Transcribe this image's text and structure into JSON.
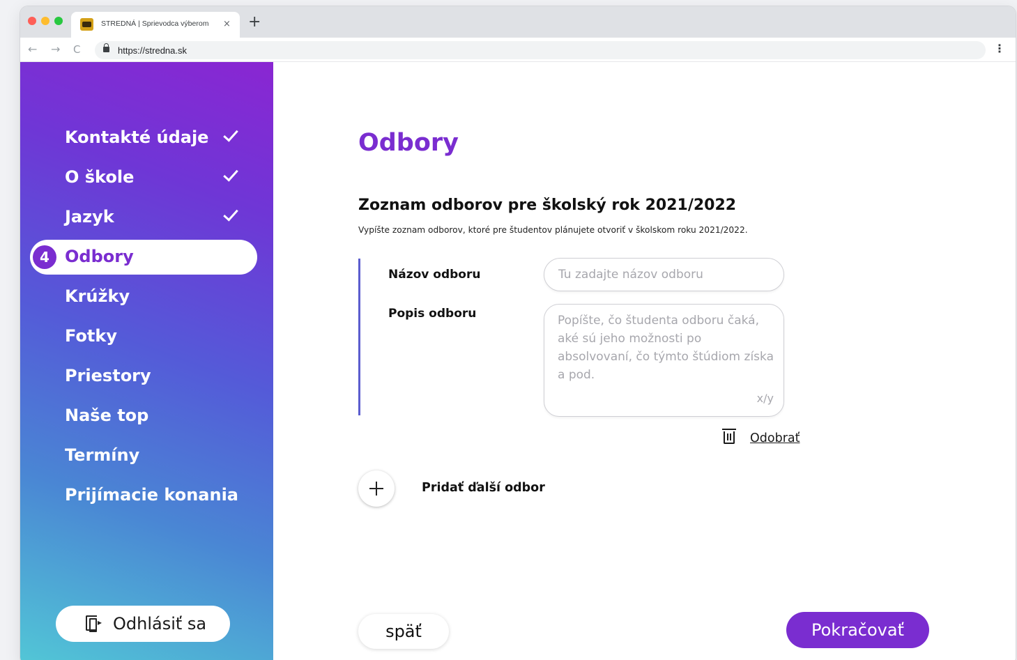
{
  "browser": {
    "tab_title": "STREDNÁ | Sprievodca výberom",
    "tab_close": "×",
    "new_tab": "+",
    "url": "https://stredna.sk",
    "back": "←",
    "forward": "→",
    "reload": "C",
    "menu": "⋮"
  },
  "sidebar": {
    "steps": [
      {
        "label": "Kontakté údaje",
        "state": "done"
      },
      {
        "label": "O škole",
        "state": "done"
      },
      {
        "label": "Jazyk",
        "state": "done"
      },
      {
        "label": "Odbory",
        "state": "active",
        "number": "4"
      },
      {
        "label": "Krúžky",
        "state": "todo"
      },
      {
        "label": "Fotky",
        "state": "todo"
      },
      {
        "label": "Priestory",
        "state": "todo"
      },
      {
        "label": "Naše top",
        "state": "todo"
      },
      {
        "label": "Termíny",
        "state": "todo"
      },
      {
        "label": "Prijímacie konania",
        "state": "todo"
      }
    ],
    "logout_label": "Odhlásiť sa"
  },
  "main": {
    "title": "Odbory",
    "section_title": "Zoznam odborov pre školský rok 2021/2022",
    "section_desc": "Vypíšte zoznam odborov, ktoré pre študentov plánujete otvoriť v školskom roku 2021/2022.",
    "name_label": "Názov odboru",
    "name_placeholder": "Tu zadajte názov odboru",
    "name_value": "",
    "desc_label": "Popis odboru",
    "desc_placeholder": "Popíšte, čo študenta odboru čaká, aké sú jeho možnosti po absolvovaní, čo týmto štúdiom získa a pod.",
    "desc_value": "",
    "counter": "x/y",
    "remove_label": "Odobrať",
    "add_label": "Pridať ďalší odbor",
    "back_label": "späť",
    "next_label": "Pokračovať"
  },
  "colors": {
    "accent": "#7a2dd0",
    "bar": "#5b5dce"
  }
}
